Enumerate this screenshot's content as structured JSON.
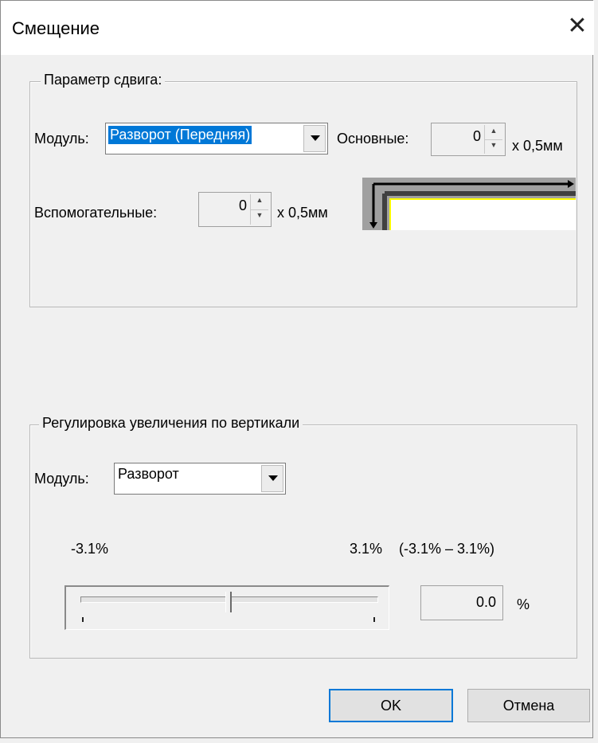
{
  "dialog": {
    "title": "Смещение",
    "close_glyph": "✕"
  },
  "shift_group": {
    "legend": "Параметр сдвига:",
    "module_label": "Модуль:",
    "module_value": "Разворот (Передняя)",
    "main_label": "Основные:",
    "main_value": "0",
    "main_unit": "x 0,5мм",
    "aux_label": "Вспомогательные:",
    "aux_value": "0",
    "aux_unit": "x 0,5мм"
  },
  "zoom_group": {
    "legend": "Регулировка увеличения по вертикали",
    "module_label": "Модуль:",
    "module_value": "Разворот",
    "min_label": "-3.1%",
    "max_label": "3.1%",
    "range_label": "(-3.1% – 3.1%)",
    "slider_value": 0.0,
    "value": "0.0",
    "unit": "%"
  },
  "buttons": {
    "ok": "OK",
    "cancel": "Отмена"
  },
  "colors": {
    "accent": "#0078d7",
    "page_highlight": "#ffff00"
  }
}
